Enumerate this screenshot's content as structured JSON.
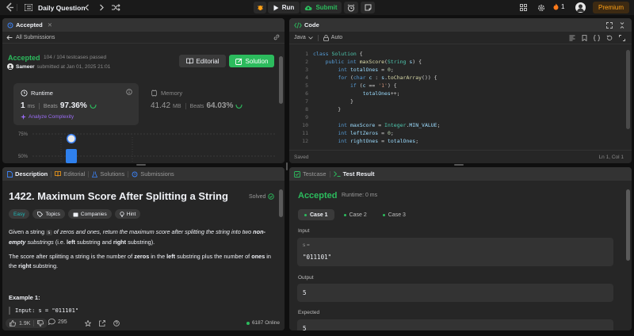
{
  "topbar": {
    "problem_list_label": "Daily Question",
    "run_label": "Run",
    "submit_label": "Submit",
    "streak_count": "1",
    "premium_label": "Premium"
  },
  "accepted_panel": {
    "tab_label": "Accepted",
    "back_label": "All Submissions",
    "status": "Accepted",
    "passed": "104 / 104 testcases passed",
    "user": "Sameer",
    "submitted_at": "submitted at Jan 01, 2025 21:01",
    "editorial_label": "Editorial",
    "solution_label": "Solution",
    "runtime": {
      "title": "Runtime",
      "value": "1",
      "unit": "ms",
      "beats_label": "Beats",
      "beats_pct": "97.36%",
      "analyze_label": "Analyze Complexity"
    },
    "memory": {
      "title": "Memory",
      "value": "41.42",
      "unit": "MB",
      "beats_label": "Beats",
      "beats_pct": "64.03%"
    },
    "chart_data": {
      "type": "bar",
      "y_ticks": [
        "75%",
        "50%"
      ]
    }
  },
  "code_panel": {
    "tab_label": "Code",
    "language": "Java",
    "auto_label": "Auto",
    "status_left": "Saved",
    "status_right": "Ln 1, Col 1",
    "line_numbers": [
      "1",
      "2",
      "3",
      "4",
      "5",
      "6",
      "7",
      "8",
      "9",
      "10",
      "11",
      "12",
      "13"
    ]
  },
  "description_panel": {
    "tabs": [
      "Description",
      "Editorial",
      "Solutions",
      "Submissions"
    ],
    "title": "1422. Maximum Score After Splitting a String",
    "solved_label": "Solved",
    "tags": [
      "Easy",
      "Topics",
      "Companies",
      "Hint"
    ],
    "example_title": "Example 1:",
    "example_input": "Input: s = \"011101\"",
    "likes": "1.9K",
    "comments": "295",
    "online": "6187 Online"
  },
  "test_panel": {
    "tabs": [
      "Testcase",
      "Test Result"
    ],
    "status": "Accepted",
    "runtime": "Runtime: 0 ms",
    "cases": [
      "Case 1",
      "Case 2",
      "Case 3"
    ],
    "input_label": "Input",
    "input_key": "s =",
    "input_value": "\"011101\"",
    "output_label": "Output",
    "output_value": "5",
    "expected_label": "Expected",
    "expected_value": "5"
  }
}
